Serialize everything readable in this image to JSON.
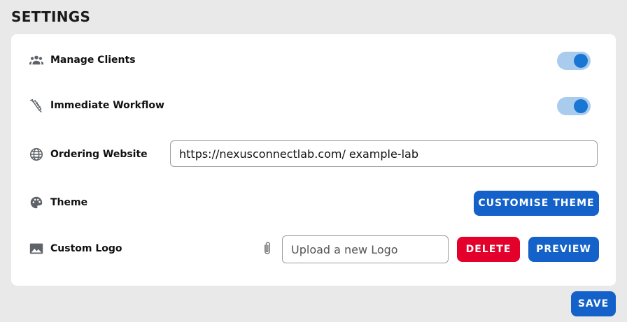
{
  "page": {
    "title": "SETTINGS"
  },
  "settings": {
    "manage_clients": {
      "label": "Manage Clients",
      "icon": "group-icon",
      "enabled": true
    },
    "immediate_workflow": {
      "label": "Immediate Workflow",
      "icon": "dental-tool-icon",
      "enabled": true
    },
    "ordering_website": {
      "label": "Ordering Website",
      "icon": "globe-icon",
      "value": "https://nexusconnectlab.com/ example-lab"
    },
    "theme": {
      "label": "Theme",
      "icon": "palette-icon",
      "button_label": "CUSTOMISE THEME"
    },
    "custom_logo": {
      "label": "Custom Logo",
      "icon": "image-icon",
      "upload_placeholder": "Upload a new Logo",
      "delete_label": "DELETE",
      "preview_label": "PREVIEW"
    }
  },
  "footer": {
    "save_label": "SAVE"
  },
  "colors": {
    "primary": "#1462c9",
    "danger": "#e3002b",
    "toggle_track": "#a9cbee",
    "toggle_knob": "#1976d2"
  }
}
